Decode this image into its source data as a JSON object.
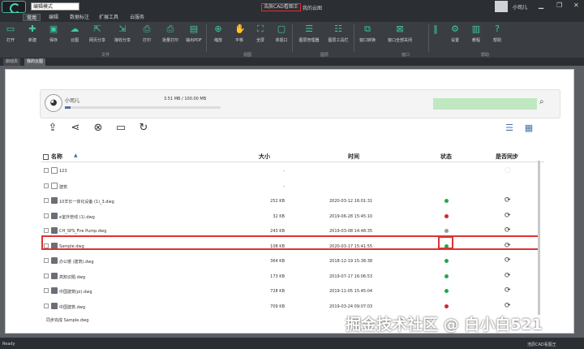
{
  "titlebar": {
    "mode_value": "编辑模式",
    "app_title": "浩辰CAD看图王",
    "doc_title": "我的云图",
    "username": "小司儿"
  },
  "menu_tabs": [
    "常用",
    "编辑",
    "数据标注",
    "扩展工具",
    "云服务"
  ],
  "ribbon": {
    "buttons": [
      {
        "label": "打开",
        "icon": "folder-open"
      },
      {
        "label": "新建",
        "icon": "plus"
      },
      {
        "label": "保存",
        "icon": "save"
      },
      {
        "label": "云图",
        "icon": "cloud"
      },
      {
        "label": "网页分享",
        "icon": "share"
      },
      {
        "label": "接收分享",
        "icon": "receive"
      },
      {
        "label": "打印",
        "icon": "printer"
      },
      {
        "label": "批量打印",
        "icon": "batch-print"
      },
      {
        "label": "输出PDF",
        "icon": "pdf"
      },
      {
        "label": "缩放",
        "icon": "zoom"
      },
      {
        "label": "平移",
        "icon": "pan"
      },
      {
        "label": "全屏",
        "icon": "fullscreen"
      },
      {
        "label": "单视口",
        "icon": "viewport"
      },
      {
        "label": "图层管理器",
        "icon": "layer-manager"
      },
      {
        "label": "图层工具栏",
        "icon": "layer-toolbar"
      },
      {
        "label": "窗口转换",
        "icon": "window-switch"
      },
      {
        "label": "窗口全部关闭",
        "icon": "close-all"
      },
      {
        "label": "设置",
        "icon": "gear"
      },
      {
        "label": "教程",
        "icon": "book"
      },
      {
        "label": "帮助",
        "icon": "help"
      }
    ],
    "groups": [
      "文件",
      "视图",
      "图层",
      "窗口",
      "帮助"
    ]
  },
  "doc_tabs": [
    "启动页",
    "我的云图"
  ],
  "profile": {
    "name": "小司儿",
    "storage": "3.51 MB / 100.00 MB",
    "storage_fraction": 0.035
  },
  "table": {
    "headers": {
      "name": "名称",
      "size": "大小",
      "time": "时间",
      "status": "状态",
      "sync": "是否同步"
    },
    "rows": [
      {
        "name": "123",
        "type": "folder",
        "size": "-",
        "date": "",
        "status": "",
        "sync": "none"
      },
      {
        "name": "建筑",
        "type": "folder",
        "size": "-",
        "date": "",
        "status": "",
        "sync": ""
      },
      {
        "name": "10羊长一体化设备 (1)_3.dwg",
        "type": "file",
        "size": "252 KB",
        "date": "2020-03-12 16:01:31",
        "status": "green",
        "sync": "yes"
      },
      {
        "name": "e室外管线 (1).dwg",
        "type": "file",
        "size": "32 KB",
        "date": "2019-06-28 15:45:10",
        "status": "red",
        "sync": "yes"
      },
      {
        "name": "CH_SPS_Fire Pump.dwg",
        "type": "file",
        "size": "243 KB",
        "date": "2019-03-08 14:48:35",
        "status": "gray",
        "sync": "yes"
      },
      {
        "name": "Sample.dwg",
        "type": "file",
        "size": "108 KB",
        "date": "2020-03-17 15:41:55",
        "status": "green",
        "sync": "yes"
      },
      {
        "name": "办公楼 (建筑).dwg",
        "type": "file",
        "size": "364 KB",
        "date": "2018-12-19 15:38:38",
        "status": "green",
        "sync": "yes"
      },
      {
        "name": "高知识题.dwg",
        "type": "file",
        "size": "173 KB",
        "date": "2019-07-17 16:06:53",
        "status": "green",
        "sync": "yes"
      },
      {
        "name": "中国建筑(pi).dwg",
        "type": "file",
        "size": "728 KB",
        "date": "2019-11-05 15:45:04",
        "status": "green",
        "sync": "yes"
      },
      {
        "name": "中国建筑.dwg",
        "type": "file",
        "size": "709 KB",
        "date": "2019-03-24 09:07:03",
        "status": "red",
        "sync": "yes"
      }
    ]
  },
  "sync_status": "同步完成 Sample.dwg",
  "statusbar": {
    "left": "Ready",
    "right": "浩辰CAD看图王"
  },
  "watermark": "掘金技术社区 @ 白小白521",
  "colors": {
    "accent": "#3cc7a6",
    "highlight": "#dd3333",
    "green": "#22aa44",
    "red": "#d02a2a",
    "gray": "#999999"
  }
}
